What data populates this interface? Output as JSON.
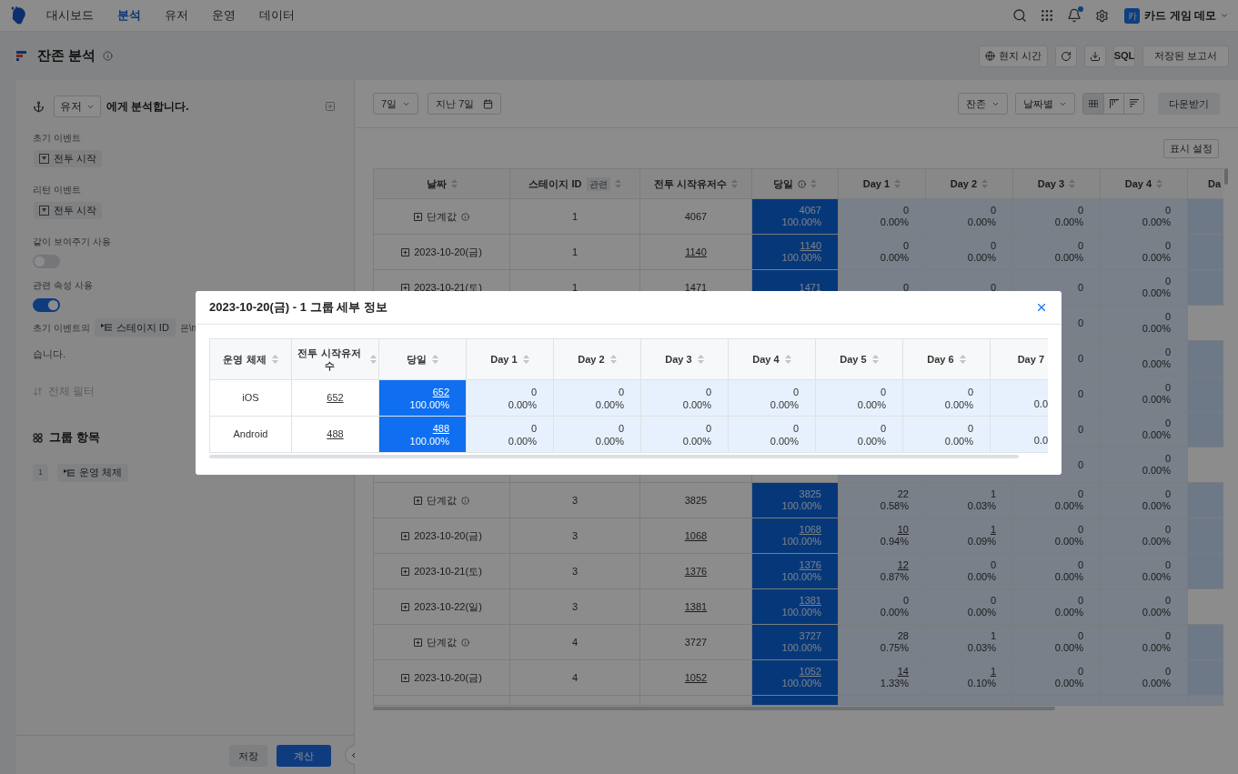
{
  "nav": {
    "items": [
      {
        "label": "대시보드",
        "selected": false
      },
      {
        "label": "분석",
        "selected": true
      },
      {
        "label": "유저",
        "selected": false
      },
      {
        "label": "운영",
        "selected": false
      },
      {
        "label": "데이터",
        "selected": false
      }
    ],
    "notification_dot": true,
    "avatar": "카",
    "project": "카드 게임 데모"
  },
  "header": {
    "title": "잔존 분석",
    "buttons": [
      {
        "kind": "timezone",
        "label": "현지 시간"
      },
      {
        "kind": "refresh"
      },
      {
        "kind": "download"
      },
      {
        "kind": "sql",
        "label": "SQL"
      },
      {
        "kind": "reports",
        "label": "저장된 보고서"
      }
    ]
  },
  "panel": {
    "subject": "유저",
    "subject_suffix": "에게 분석합니다.",
    "events": [
      {
        "label": "초기 이벤트",
        "chip": "전투 시작"
      },
      {
        "label": "리턴 이벤트",
        "chip": "전투 시작"
      }
    ],
    "toggles": [
      {
        "label": "같이 보여주기 사용",
        "on": false
      },
      {
        "label": "관련 속성 사용",
        "on": true
      }
    ],
    "sentence": {
      "before": "초기 이벤트의",
      "chip": "스테이지 ID",
      "after": "은\\n",
      "next_line": "습니다."
    },
    "filter": "전체 필터",
    "group": {
      "title": "그룹 항목",
      "items": [
        {
          "index": "1",
          "chip": "운영 체제"
        }
      ]
    },
    "save": "저장",
    "calculate": "계산"
  },
  "toolbar": {
    "period": "7일",
    "range": "지난 7일",
    "metric": "잔존",
    "grouping": "날짜별",
    "views": [
      {
        "kind": "table",
        "selected": true
      },
      {
        "kind": "stair",
        "selected": false
      },
      {
        "kind": "stair_alt",
        "selected": false
      }
    ],
    "download": "다운받기",
    "display_settings": "표시 설정"
  },
  "table": {
    "columns": [
      {
        "label": "날짜"
      },
      {
        "label": "스테이지 ID",
        "tag": "관련"
      },
      {
        "label": "전투 시작유저수"
      },
      {
        "label": "당일",
        "info": true
      },
      {
        "label": "Day 1"
      },
      {
        "label": "Day 2"
      },
      {
        "label": "Day 3"
      },
      {
        "label": "Day 4"
      },
      {
        "label": "Da"
      }
    ],
    "rows": [
      {
        "kind": "total",
        "date": "단계값",
        "stage": "1",
        "users": "4067",
        "same_day": {
          "count": "4067",
          "pct": "100.00%"
        },
        "days": [
          {
            "count": "0",
            "pct": "0.00%",
            "linked": false
          },
          {
            "count": "0",
            "pct": "0.00%",
            "linked": false
          },
          {
            "count": "0",
            "pct": "0.00%",
            "linked": false
          },
          {
            "count": "0",
            "pct": "0.00%",
            "linked": false
          }
        ],
        "day_5_shaded": true
      },
      {
        "kind": "date",
        "date": "2023-10-20(금)",
        "stage": "1",
        "users": "1140",
        "same_day": {
          "count": "1140",
          "pct": "100.00%"
        },
        "days": [
          {
            "count": "0",
            "pct": "0.00%",
            "linked": false
          },
          {
            "count": "0",
            "pct": "0.00%",
            "linked": false
          },
          {
            "count": "0",
            "pct": "0.00%",
            "linked": false
          },
          {
            "count": "0",
            "pct": "0.00%",
            "linked": false
          }
        ],
        "day_5_shaded": true
      },
      {
        "kind": "date",
        "date": "2023-10-21(토)",
        "stage": "1",
        "users": "1471",
        "same_day": {
          "count": "1471"
        },
        "days": [
          {
            "count": "0"
          },
          {
            "count": "0"
          },
          {
            "count": "0"
          },
          {
            "count": "0",
            "pct": "0.00%",
            "linked": false
          }
        ],
        "day_5_shaded": true
      },
      {
        "kind": "covered",
        "day_3": {
          "count": "0"
        },
        "day_4": {
          "count": "0",
          "pct": "0.00%",
          "linked": false
        },
        "day_5_shaded": false
      },
      {
        "kind": "covered",
        "day_3": {
          "count": "0"
        },
        "day_4": {
          "count": "0",
          "pct": "0.00%",
          "linked": false
        },
        "day_5_shaded": true
      },
      {
        "kind": "covered",
        "day_3": {
          "count": "0"
        },
        "day_4": {
          "count": "0",
          "pct": "0.00%",
          "linked": false
        },
        "day_5_shaded": true
      },
      {
        "kind": "covered",
        "day_3": {
          "count": "0"
        },
        "day_4": {
          "count": "0",
          "pct": "0.00%",
          "linked": false
        },
        "day_5_shaded": true
      },
      {
        "kind": "covered",
        "day_3": {
          "count": "0"
        },
        "day_4": {
          "count": "0",
          "pct": "0.00%",
          "linked": false
        },
        "day_5_shaded": false
      },
      {
        "kind": "total",
        "date": "단계값",
        "stage": "3",
        "users": "3825",
        "same_day": {
          "count": "3825",
          "pct": "100.00%"
        },
        "days": [
          {
            "count": "22",
            "pct": "0.58%",
            "linked": false
          },
          {
            "count": "1",
            "pct": "0.03%",
            "linked": false
          },
          {
            "count": "0",
            "pct": "0.00%",
            "linked": false
          },
          {
            "count": "0",
            "pct": "0.00%",
            "linked": false
          }
        ],
        "day_5_shaded": true
      },
      {
        "kind": "date",
        "date": "2023-10-20(금)",
        "stage": "3",
        "users": "1068",
        "same_day": {
          "count": "1068",
          "pct": "100.00%"
        },
        "days": [
          {
            "count": "10",
            "pct": "0.94%",
            "linked": true
          },
          {
            "count": "1",
            "pct": "0.09%",
            "linked": true
          },
          {
            "count": "0",
            "pct": "0.00%",
            "linked": false
          },
          {
            "count": "0",
            "pct": "0.00%",
            "linked": false
          }
        ],
        "day_5_shaded": true
      },
      {
        "kind": "date",
        "date": "2023-10-21(토)",
        "stage": "3",
        "users": "1376",
        "same_day": {
          "count": "1376",
          "pct": "100.00%"
        },
        "days": [
          {
            "count": "12",
            "pct": "0.87%",
            "linked": true
          },
          {
            "count": "0",
            "pct": "0.00%",
            "linked": false
          },
          {
            "count": "0",
            "pct": "0.00%",
            "linked": false
          },
          {
            "count": "0",
            "pct": "0.00%",
            "linked": false
          }
        ],
        "day_5_shaded": true
      },
      {
        "kind": "date",
        "date": "2023-10-22(일)",
        "stage": "3",
        "users": "1381",
        "same_day": {
          "count": "1381",
          "pct": "100.00%"
        },
        "days": [
          {
            "count": "0",
            "pct": "0.00%",
            "linked": false
          },
          {
            "count": "0",
            "pct": "0.00%",
            "linked": false
          },
          {
            "count": "0",
            "pct": "0.00%",
            "linked": false
          },
          {
            "count": "0",
            "pct": "0.00%",
            "linked": false
          }
        ],
        "day_5_shaded": false
      },
      {
        "kind": "total",
        "date": "단계값",
        "stage": "4",
        "users": "3727",
        "same_day": {
          "count": "3727",
          "pct": "100.00%"
        },
        "days": [
          {
            "count": "28",
            "pct": "0.75%",
            "linked": false
          },
          {
            "count": "1",
            "pct": "0.03%",
            "linked": false
          },
          {
            "count": "0",
            "pct": "0.00%",
            "linked": false
          },
          {
            "count": "0",
            "pct": "0.00%",
            "linked": false
          }
        ],
        "day_5_shaded": true
      },
      {
        "kind": "date",
        "date": "2023-10-20(금)",
        "stage": "4",
        "users": "1052",
        "same_day": {
          "count": "1052",
          "pct": "100.00%"
        },
        "days": [
          {
            "count": "14",
            "pct": "1.33%",
            "linked": true
          },
          {
            "count": "1",
            "pct": "0.10%",
            "linked": true
          },
          {
            "count": "0",
            "pct": "0.00%",
            "linked": false
          },
          {
            "count": "0",
            "pct": "0.00%",
            "linked": false
          }
        ],
        "day_5_shaded": true
      }
    ]
  },
  "dialog": {
    "title": "2023-10-20(금) - 1 그룹 세부 정보",
    "columns": [
      "운영 체제",
      "전투 시작유저 수",
      "당일",
      "Day 1",
      "Day 2",
      "Day 3",
      "Day 4",
      "Day 5",
      "Day 6",
      "Day 7"
    ],
    "rows": [
      {
        "os": "iOS",
        "users": "652",
        "same_day": {
          "count": "652",
          "pct": "100.00%"
        },
        "days": [
          {
            "count": "0",
            "pct": "0.00%"
          },
          {
            "count": "0",
            "pct": "0.00%"
          },
          {
            "count": "0",
            "pct": "0.00%"
          },
          {
            "count": "0",
            "pct": "0.00%"
          },
          {
            "count": "0",
            "pct": "0.00%"
          },
          {
            "count": "0",
            "pct": "0.00%"
          }
        ],
        "day_7": "0.0"
      },
      {
        "os": "Android",
        "users": "488",
        "same_day": {
          "count": "488",
          "pct": "100.00%"
        },
        "days": [
          {
            "count": "0",
            "pct": "0.00%"
          },
          {
            "count": "0",
            "pct": "0.00%"
          },
          {
            "count": "0",
            "pct": "0.00%"
          },
          {
            "count": "0",
            "pct": "0.00%"
          },
          {
            "count": "0",
            "pct": "0.00%"
          },
          {
            "count": "0",
            "pct": "0.00%"
          }
        ],
        "day_7": "0.0"
      }
    ]
  }
}
